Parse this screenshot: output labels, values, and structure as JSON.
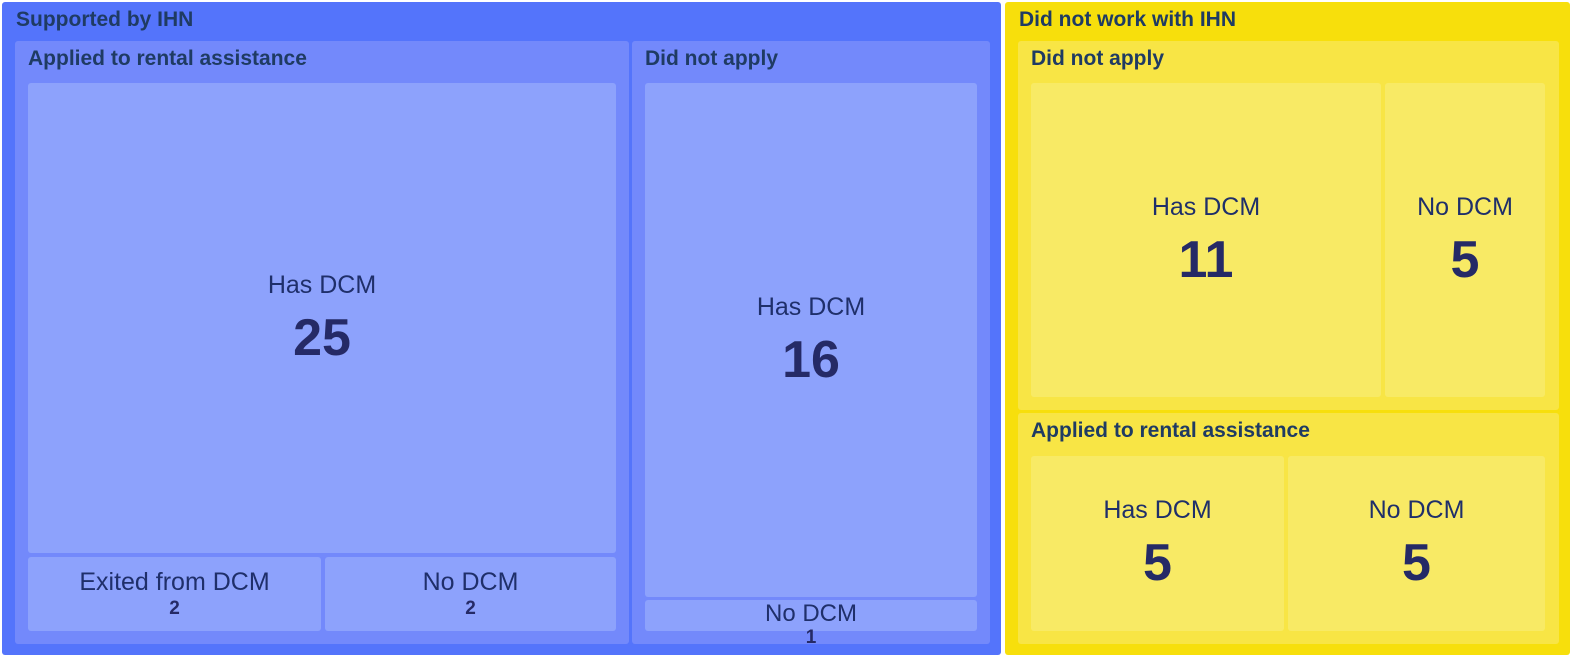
{
  "chart_data": {
    "type": "treemap",
    "groups": [
      {
        "name": "Supported by IHN",
        "color": "#5474fb",
        "children": [
          {
            "name": "Applied to rental assistance",
            "children": [
              {
                "name": "Has DCM",
                "value": 25
              },
              {
                "name": "Exited from DCM",
                "value": 2
              },
              {
                "name": "No DCM",
                "value": 2
              }
            ]
          },
          {
            "name": "Did not apply",
            "children": [
              {
                "name": "Has DCM",
                "value": 16
              },
              {
                "name": "No DCM",
                "value": 1
              }
            ]
          }
        ]
      },
      {
        "name": "Did not work with IHN",
        "color": "#f7df0c",
        "children": [
          {
            "name": "Did not apply",
            "children": [
              {
                "name": "Has DCM",
                "value": 11
              },
              {
                "name": "No DCM",
                "value": 5
              }
            ]
          },
          {
            "name": "Applied to rental assistance",
            "children": [
              {
                "name": "Has DCM",
                "value": 5
              },
              {
                "name": "No DCM",
                "value": 5
              }
            ]
          }
        ]
      }
    ]
  },
  "colors": {
    "blue_outer": "#5474fb",
    "blue_mid": "#7389fb",
    "blue_leaf": "#8da2fc",
    "yellow_outer": "#f7df0c",
    "yellow_mid": "#f8e545",
    "yellow_leaf": "#f8ea65"
  }
}
